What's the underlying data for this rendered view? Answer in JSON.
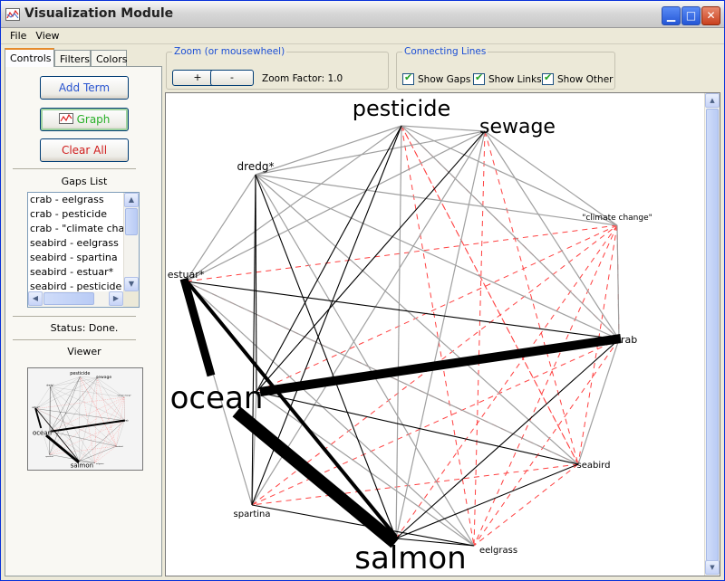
{
  "window": {
    "title": "Visualization Module"
  },
  "menu": [
    "File",
    "View"
  ],
  "tabs": [
    "Controls",
    "Filters",
    "Colors"
  ],
  "controls": {
    "add_term": "Add Term",
    "graph": "Graph",
    "clear_all": "Clear All",
    "gaps_title": "Gaps List",
    "gaps": [
      "crab - eelgrass",
      "crab - pesticide",
      "crab - \"climate change\"",
      "seabird - eelgrass",
      "seabird - spartina",
      "seabird - estuar*",
      "seabird - pesticide"
    ],
    "status": "Status: Done.",
    "viewer_title": "Viewer"
  },
  "zoom": {
    "legend": "Zoom (or mousewheel)",
    "plus": "+",
    "minus": "-",
    "factor_label": "Zoom Factor: 1.0"
  },
  "connecting": {
    "legend": "Connecting Lines",
    "show_gaps": "Show Gaps",
    "show_links": "Show Links",
    "show_other": "Show Other"
  },
  "graph": {
    "nodes": [
      {
        "id": "pesticide",
        "label": "pesticide"
      },
      {
        "id": "sewage",
        "label": "sewage"
      },
      {
        "id": "dredg",
        "label": "dredg*"
      },
      {
        "id": "climate",
        "label": "\"climate change\""
      },
      {
        "id": "estuar",
        "label": "estuar*"
      },
      {
        "id": "crab",
        "label": "rab"
      },
      {
        "id": "ocean",
        "label": "ocean"
      },
      {
        "id": "seabird",
        "label": "seabird"
      },
      {
        "id": "spartina",
        "label": "spartina"
      },
      {
        "id": "salmon",
        "label": "salmon"
      },
      {
        "id": "eelgrass",
        "label": "eelgrass"
      }
    ],
    "colors": {
      "link": "#000000",
      "other": "#a0a0a0",
      "gap": "#ff4040"
    },
    "links_strong": [
      [
        "estuar",
        "ocean",
        9
      ],
      [
        "ocean",
        "crab",
        10
      ],
      [
        "ocean",
        "salmon",
        12
      ],
      [
        "estuar",
        "salmon",
        4
      ]
    ],
    "links": [
      [
        "pesticide",
        "ocean"
      ],
      [
        "dredg",
        "ocean"
      ],
      [
        "sewage",
        "ocean"
      ],
      [
        "dredg",
        "spartina"
      ],
      [
        "estuar",
        "crab"
      ],
      [
        "ocean",
        "seabird"
      ],
      [
        "crab",
        "salmon"
      ],
      [
        "seabird",
        "salmon"
      ],
      [
        "eelgrass",
        "salmon"
      ],
      [
        "pesticide",
        "spartina"
      ],
      [
        "dredg",
        "salmon"
      ],
      [
        "spartina",
        "eelgrass"
      ]
    ],
    "others": [
      [
        "pesticide",
        "sewage"
      ],
      [
        "pesticide",
        "dredg"
      ],
      [
        "pesticide",
        "estuar"
      ],
      [
        "pesticide",
        "salmon"
      ],
      [
        "sewage",
        "estuar"
      ],
      [
        "sewage",
        "dredg"
      ],
      [
        "sewage",
        "climate"
      ],
      [
        "sewage",
        "crab"
      ],
      [
        "dredg",
        "estuar"
      ],
      [
        "dredg",
        "crab"
      ],
      [
        "dredg",
        "seabird"
      ],
      [
        "dredg",
        "climate"
      ],
      [
        "estuar",
        "spartina"
      ],
      [
        "estuar",
        "seabird"
      ],
      [
        "ocean",
        "spartina"
      ],
      [
        "sewage",
        "spartina"
      ],
      [
        "pesticide",
        "crab"
      ],
      [
        "climate",
        "crab"
      ],
      [
        "dredg",
        "eelgrass"
      ],
      [
        "estuar",
        "eelgrass"
      ],
      [
        "crab",
        "seabird"
      ],
      [
        "ocean",
        "eelgrass"
      ],
      [
        "sewage",
        "salmon"
      ],
      [
        "pesticide",
        "climate"
      ]
    ],
    "gaps": [
      [
        "crab",
        "eelgrass"
      ],
      [
        "crab",
        "pesticide"
      ],
      [
        "crab",
        "climate"
      ],
      [
        "seabird",
        "eelgrass"
      ],
      [
        "seabird",
        "spartina"
      ],
      [
        "seabird",
        "estuar"
      ],
      [
        "seabird",
        "pesticide"
      ],
      [
        "climate",
        "salmon"
      ],
      [
        "climate",
        "estuar"
      ],
      [
        "climate",
        "ocean"
      ],
      [
        "climate",
        "eelgrass"
      ],
      [
        "climate",
        "seabird"
      ],
      [
        "pesticide",
        "eelgrass"
      ],
      [
        "sewage",
        "eelgrass"
      ],
      [
        "sewage",
        "seabird"
      ],
      [
        "spartina",
        "climate"
      ],
      [
        "spartina",
        "crab"
      ],
      [
        "estuar",
        "salmon"
      ],
      [
        "pesticide",
        "seabird"
      ]
    ]
  }
}
